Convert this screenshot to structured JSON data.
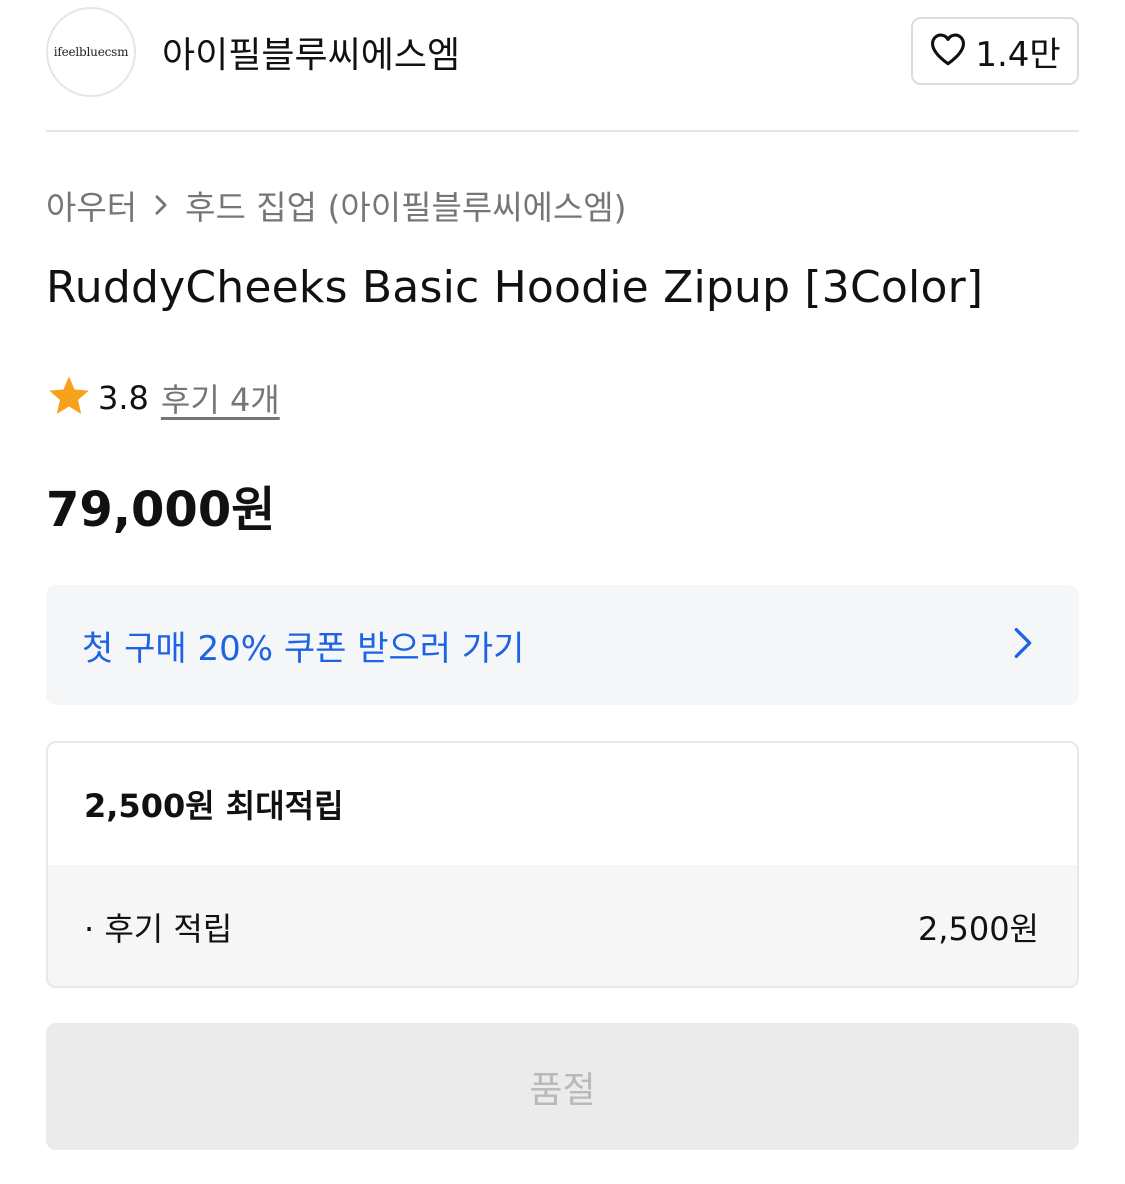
{
  "brand": {
    "logo_text": "ifeelbluecsm",
    "name": "아이필블루씨에스엠",
    "like_count": "1.4만"
  },
  "breadcrumb": {
    "category": "아우터",
    "subcategory": "후드 집업 (아이필블루씨에스엠)"
  },
  "product": {
    "title": "RuddyCheeks Basic Hoodie Zipup [3Color]",
    "rating": "3.8",
    "review_link": "후기 4개",
    "price": "79,000원"
  },
  "coupon": {
    "text": "첫 구매 20% 쿠폰 받으러 가기"
  },
  "points": {
    "max_label": "2,500원 최대적립",
    "rows": [
      {
        "label": "· 후기 적립",
        "amount": "2,500원"
      }
    ]
  },
  "purchase": {
    "button_label": "품절"
  },
  "colors": {
    "accent_blue": "#1e63e6",
    "star": "#f7a21b",
    "muted_text": "#767676",
    "disabled_text": "#b9b9b9"
  },
  "icons": {
    "like": "heart-icon",
    "breadcrumb_separator": "chevron-right-icon",
    "rating": "star-icon",
    "coupon_arrow": "chevron-right-icon"
  }
}
